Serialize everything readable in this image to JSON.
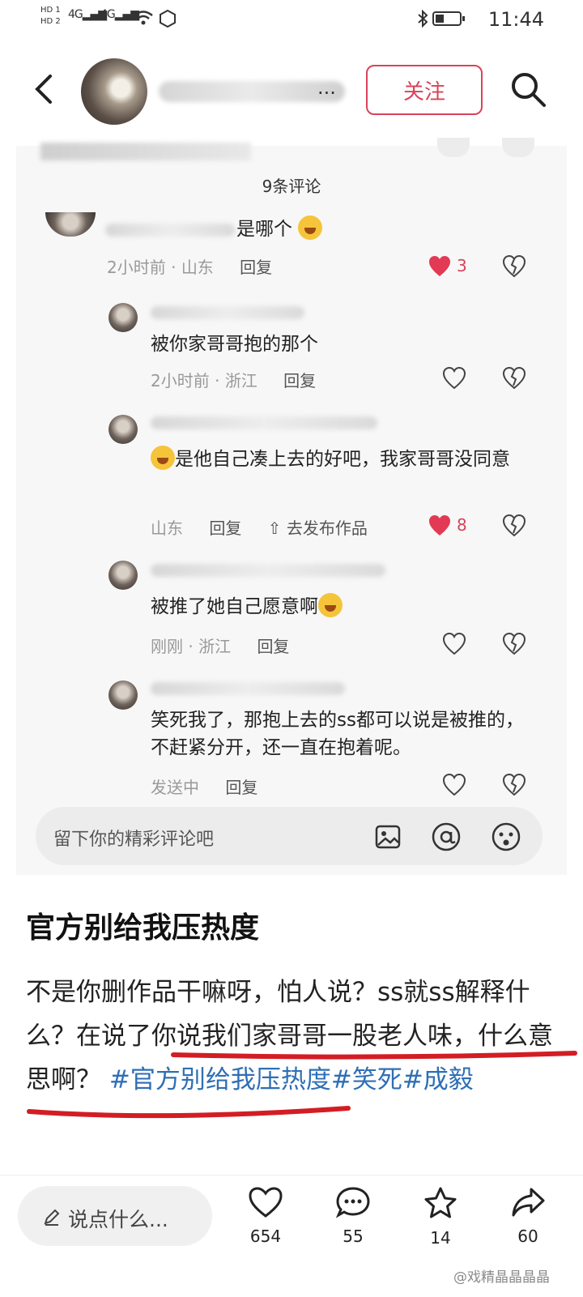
{
  "status": {
    "time": "11:44",
    "left_top": "HD 1",
    "left_bottom": "HD 2",
    "net1": "4G",
    "net2": "4G"
  },
  "header": {
    "follow_label": "关注",
    "name_tail": "..."
  },
  "comments": {
    "count_label": "9条评论",
    "items": [
      {
        "text": "是哪个",
        "time": "2小时前",
        "location": "山东",
        "reply": "回复",
        "likes": "3"
      },
      {
        "text": "被你家哥哥抱的那个",
        "time": "2小时前",
        "location": "浙江",
        "reply": "回复"
      },
      {
        "text": "是他自己凑上去的好吧，我家哥哥没同意",
        "location": "山东",
        "reply": "回复",
        "extra": "去发布作品",
        "likes": "8"
      },
      {
        "text": "被推了她自己愿意啊",
        "time": "刚刚",
        "location": "浙江",
        "reply": "回复"
      },
      {
        "text": "笑死我了，那抱上去的ss都可以说是被推的，不赶紧分开，还一直在抱着呢。",
        "time": "发送中",
        "reply": "回复"
      }
    ],
    "input_placeholder": "留下你的精彩评论吧"
  },
  "post": {
    "title": "官方别给我压热度",
    "body_plain": "不是你删作品干嘛呀，怕人说？ss就ss解释什么？在说了你说我们家哥哥一股老人味，什么意思啊？",
    "tags": [
      "#官方别给我压热度",
      "#笑死",
      "#成毅"
    ]
  },
  "bottom": {
    "say_placeholder": "说点什么...",
    "likes": "654",
    "comments": "55",
    "favorites": "14",
    "shares": "60"
  },
  "watermark": "@戏精晶晶晶晶",
  "colors": {
    "accent": "#d9435a",
    "tag": "#2f6fb5",
    "annotation": "#d31d24"
  }
}
